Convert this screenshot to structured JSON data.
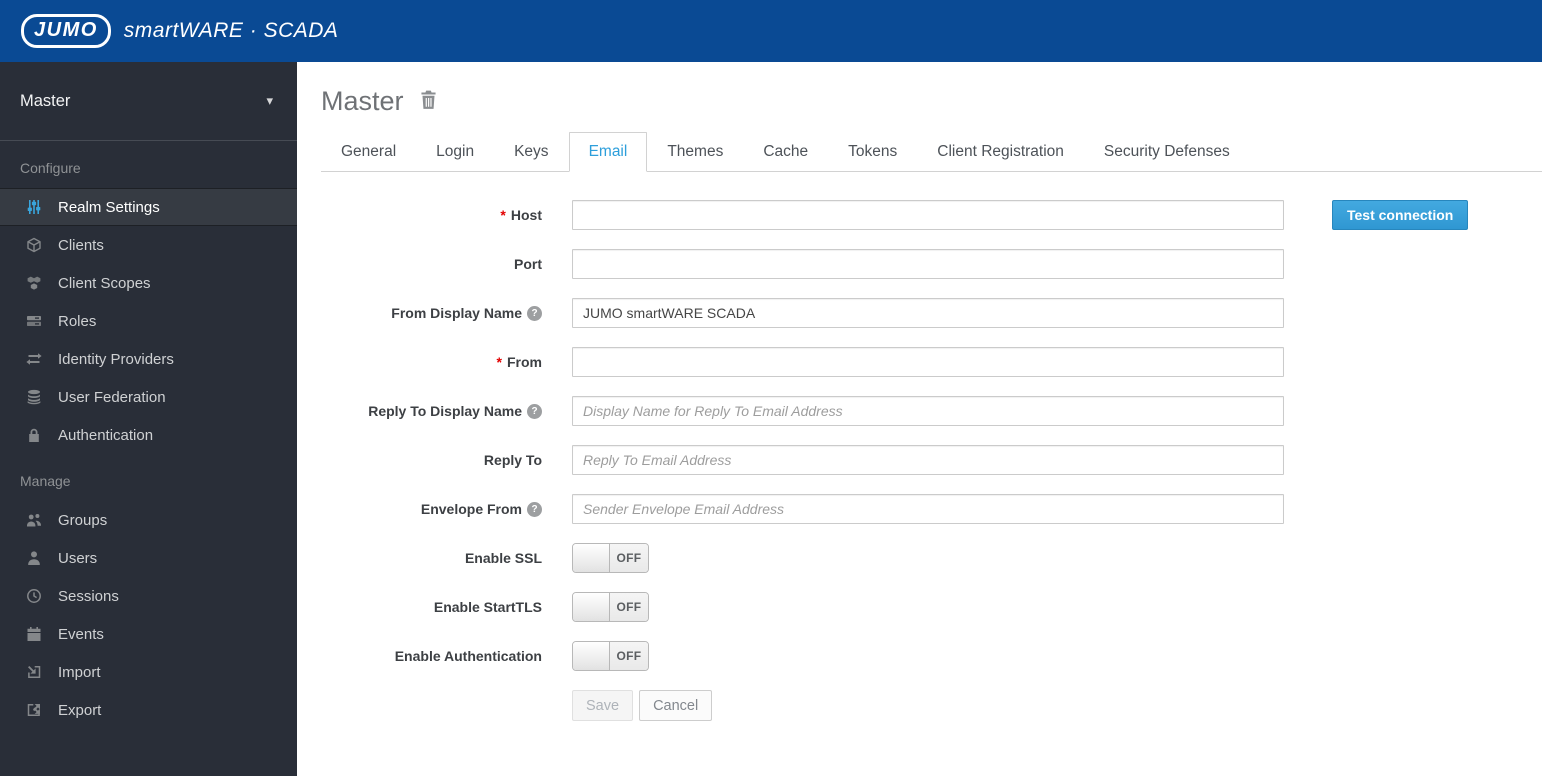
{
  "colors": {
    "topbar_blue": "#0a4a94",
    "sidebar_bg": "#292e38",
    "accent_blue": "#39a5dc",
    "active_tab_blue": "#2e9fdb",
    "required_red": "#e20000"
  },
  "icons": {
    "chevron_down": "▾",
    "help": "?",
    "required_marker": "*"
  },
  "topbar": {
    "logo_text": "JUMO",
    "brand_text": "smartWARE · SCADA"
  },
  "sidebar": {
    "realm_selector": {
      "label": "Master"
    },
    "sections": [
      {
        "label": "Configure",
        "items": [
          {
            "label": "Realm Settings",
            "icon": "sliders-icon",
            "active": true
          },
          {
            "label": "Clients",
            "icon": "cube-icon",
            "active": false
          },
          {
            "label": "Client Scopes",
            "icon": "cubes-icon",
            "active": false
          },
          {
            "label": "Roles",
            "icon": "list-icon",
            "active": false
          },
          {
            "label": "Identity Providers",
            "icon": "exchange-arrows-icon",
            "active": false
          },
          {
            "label": "User Federation",
            "icon": "database-icon",
            "active": false
          },
          {
            "label": "Authentication",
            "icon": "lock-icon",
            "active": false
          }
        ]
      },
      {
        "label": "Manage",
        "items": [
          {
            "label": "Groups",
            "icon": "group-icon",
            "active": false
          },
          {
            "label": "Users",
            "icon": "user-icon",
            "active": false
          },
          {
            "label": "Sessions",
            "icon": "clock-icon",
            "active": false
          },
          {
            "label": "Events",
            "icon": "calendar-icon",
            "active": false
          },
          {
            "label": "Import",
            "icon": "import-icon",
            "active": false
          },
          {
            "label": "Export",
            "icon": "export-icon",
            "active": false
          }
        ]
      }
    ]
  },
  "main": {
    "title": "Master",
    "tabs": [
      {
        "label": "General",
        "active": false
      },
      {
        "label": "Login",
        "active": false
      },
      {
        "label": "Keys",
        "active": false
      },
      {
        "label": "Email",
        "active": true
      },
      {
        "label": "Themes",
        "active": false
      },
      {
        "label": "Cache",
        "active": false
      },
      {
        "label": "Tokens",
        "active": false
      },
      {
        "label": "Client Registration",
        "active": false
      },
      {
        "label": "Security Defenses",
        "active": false
      }
    ],
    "form": {
      "fields": {
        "host": {
          "label": "Host",
          "required": true,
          "value": ""
        },
        "port": {
          "label": "Port",
          "value": ""
        },
        "from_display_name": {
          "label": "From Display Name",
          "has_help": true,
          "value": "JUMO smartWARE SCADA"
        },
        "from": {
          "label": "From",
          "required": true,
          "value": ""
        },
        "reply_to_display_name": {
          "label": "Reply To Display Name",
          "has_help": true,
          "value": "",
          "placeholder": "Display Name for Reply To Email Address"
        },
        "reply_to": {
          "label": "Reply To",
          "value": "",
          "placeholder": "Reply To Email Address"
        },
        "envelope_from": {
          "label": "Envelope From",
          "has_help": true,
          "value": "",
          "placeholder": "Sender Envelope Email Address"
        },
        "enable_ssl": {
          "label": "Enable SSL",
          "state": "OFF"
        },
        "enable_starttls": {
          "label": "Enable StartTLS",
          "state": "OFF"
        },
        "enable_authentication": {
          "label": "Enable Authentication",
          "state": "OFF"
        }
      },
      "buttons": {
        "test_connection": "Test connection",
        "save": "Save",
        "cancel": "Cancel"
      }
    }
  }
}
